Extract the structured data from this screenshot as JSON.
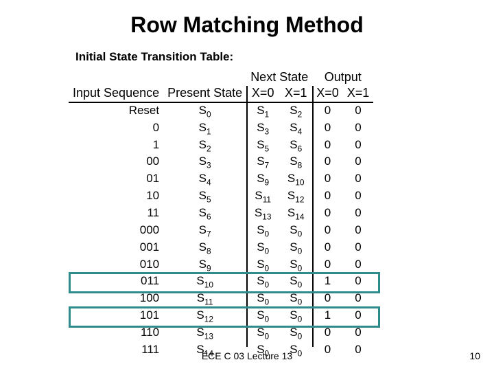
{
  "title": "Row Matching Method",
  "subtitle": "Initial State Transition Table:",
  "headers": {
    "nextState": "Next State",
    "output": "Output",
    "inputSeq": "Input Sequence",
    "presentState": "Present State",
    "x0": "X=0",
    "x1": "X=1"
  },
  "rows": [
    {
      "seq": "Reset",
      "present": "S0",
      "nx0": "S1",
      "nx1": "S2",
      "o0": "0",
      "o1": "0"
    },
    {
      "seq": "0",
      "present": "S1",
      "nx0": "S3",
      "nx1": "S4",
      "o0": "0",
      "o1": "0"
    },
    {
      "seq": "1",
      "present": "S2",
      "nx0": "S5",
      "nx1": "S6",
      "o0": "0",
      "o1": "0"
    },
    {
      "seq": "00",
      "present": "S3",
      "nx0": "S7",
      "nx1": "S8",
      "o0": "0",
      "o1": "0"
    },
    {
      "seq": "01",
      "present": "S4",
      "nx0": "S9",
      "nx1": "S10",
      "o0": "0",
      "o1": "0"
    },
    {
      "seq": "10",
      "present": "S5",
      "nx0": "S11",
      "nx1": "S12",
      "o0": "0",
      "o1": "0"
    },
    {
      "seq": "11",
      "present": "S6",
      "nx0": "S13",
      "nx1": "S14",
      "o0": "0",
      "o1": "0"
    },
    {
      "seq": "000",
      "present": "S7",
      "nx0": "S0",
      "nx1": "S0",
      "o0": "0",
      "o1": "0"
    },
    {
      "seq": "001",
      "present": "S8",
      "nx0": "S0",
      "nx1": "S0",
      "o0": "0",
      "o1": "0"
    },
    {
      "seq": "010",
      "present": "S9",
      "nx0": "S0",
      "nx1": "S0",
      "o0": "0",
      "o1": "0"
    },
    {
      "seq": "011",
      "present": "S10",
      "nx0": "S0",
      "nx1": "S0",
      "o0": "1",
      "o1": "0"
    },
    {
      "seq": "100",
      "present": "S11",
      "nx0": "S0",
      "nx1": "S0",
      "o0": "0",
      "o1": "0"
    },
    {
      "seq": "101",
      "present": "S12",
      "nx0": "S0",
      "nx1": "S0",
      "o0": "1",
      "o1": "0"
    },
    {
      "seq": "110",
      "present": "S13",
      "nx0": "S0",
      "nx1": "S0",
      "o0": "0",
      "o1": "0"
    },
    {
      "seq": "111",
      "present": "S14",
      "nx0": "S0",
      "nx1": "S0",
      "o0": "0",
      "o1": "0"
    }
  ],
  "highlightRows": [
    10,
    12
  ],
  "footer": "ECE C 03 Lecture 13",
  "pageNumber": "10",
  "chart_data": {
    "type": "table",
    "title": "Initial State Transition Table",
    "columns": [
      "Input Sequence",
      "Present State",
      "Next State X=0",
      "Next State X=1",
      "Output X=0",
      "Output X=1"
    ],
    "rows": [
      [
        "Reset",
        "S0",
        "S1",
        "S2",
        "0",
        "0"
      ],
      [
        "0",
        "S1",
        "S3",
        "S4",
        "0",
        "0"
      ],
      [
        "1",
        "S2",
        "S5",
        "S6",
        "0",
        "0"
      ],
      [
        "00",
        "S3",
        "S7",
        "S8",
        "0",
        "0"
      ],
      [
        "01",
        "S4",
        "S9",
        "S10",
        "0",
        "0"
      ],
      [
        "10",
        "S5",
        "S11",
        "S12",
        "0",
        "0"
      ],
      [
        "11",
        "S6",
        "S13",
        "S14",
        "0",
        "0"
      ],
      [
        "000",
        "S7",
        "S0",
        "S0",
        "0",
        "0"
      ],
      [
        "001",
        "S8",
        "S0",
        "S0",
        "0",
        "0"
      ],
      [
        "010",
        "S9",
        "S0",
        "S0",
        "0",
        "0"
      ],
      [
        "011",
        "S10",
        "S0",
        "S0",
        "1",
        "0"
      ],
      [
        "100",
        "S11",
        "S0",
        "S0",
        "0",
        "0"
      ],
      [
        "101",
        "S12",
        "S0",
        "S0",
        "1",
        "0"
      ],
      [
        "110",
        "S13",
        "S0",
        "S0",
        "0",
        "0"
      ],
      [
        "111",
        "S14",
        "S0",
        "S0",
        "0",
        "0"
      ]
    ]
  }
}
